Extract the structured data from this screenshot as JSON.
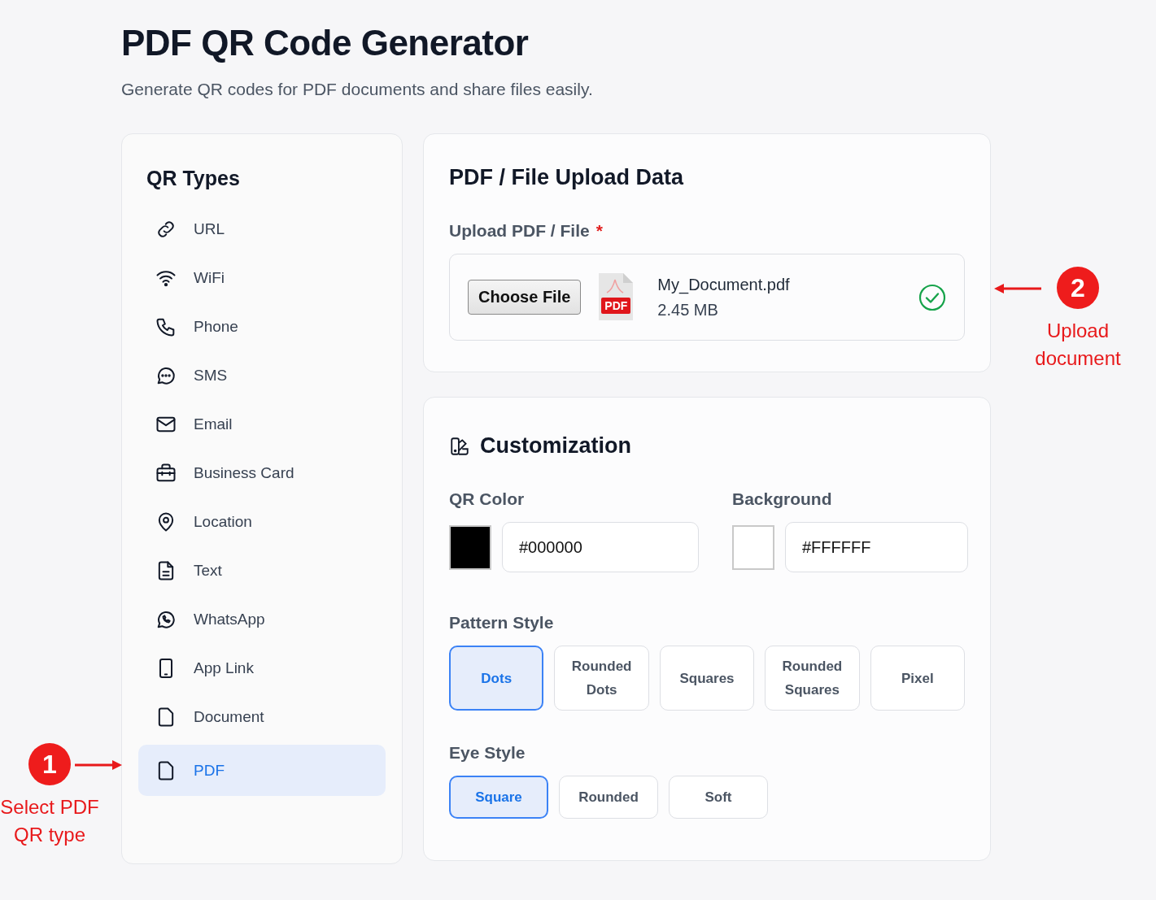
{
  "header": {
    "title": "PDF QR Code Generator",
    "subtitle": "Generate QR codes for PDF documents and share files easily."
  },
  "sidebar": {
    "title": "QR Types",
    "items": [
      {
        "kind": "link",
        "label": "URL",
        "selected": false
      },
      {
        "kind": "wifi",
        "label": "WiFi",
        "selected": false
      },
      {
        "kind": "phone",
        "label": "Phone",
        "selected": false
      },
      {
        "kind": "chat",
        "label": "SMS",
        "selected": false
      },
      {
        "kind": "mail",
        "label": "Email",
        "selected": false
      },
      {
        "kind": "briefcase",
        "label": "Business Card",
        "selected": false
      },
      {
        "kind": "pin",
        "label": "Location",
        "selected": false
      },
      {
        "kind": "text",
        "label": "Text",
        "selected": false
      },
      {
        "kind": "whatsapp",
        "label": "WhatsApp",
        "selected": false
      },
      {
        "kind": "device",
        "label": "App Link",
        "selected": false
      },
      {
        "kind": "file",
        "label": "Document",
        "selected": false
      },
      {
        "kind": "file",
        "label": "PDF",
        "selected": true
      }
    ]
  },
  "upload": {
    "title": "PDF / File Upload Data",
    "label": "Upload PDF / File",
    "required_mark": "*",
    "button": "Choose File",
    "file_badge": "PDF",
    "file_name": "My_Document.pdf",
    "file_size": "2.45 MB"
  },
  "customization": {
    "title": "Customization",
    "colors": [
      {
        "label": "QR Color",
        "value": "#000000",
        "color": "#000000"
      },
      {
        "label": "Background",
        "value": "#FFFFFF",
        "color": "#ffffff"
      }
    ],
    "pattern_style": {
      "label": "Pattern Style",
      "options": [
        {
          "label": "Dots",
          "selected": true
        },
        {
          "label": "Rounded Dots",
          "selected": false
        },
        {
          "label": "Squares",
          "selected": false
        },
        {
          "label": "Rounded Squares",
          "selected": false
        },
        {
          "label": "Pixel",
          "selected": false
        }
      ]
    },
    "eye_style": {
      "label": "Eye Style",
      "options": [
        {
          "label": "Square",
          "selected": true
        },
        {
          "label": "Rounded",
          "selected": false
        },
        {
          "label": "Soft",
          "selected": false
        }
      ]
    }
  },
  "annotations": [
    {
      "number": "1",
      "label": "Select PDF QR type",
      "kind": "left"
    },
    {
      "number": "2",
      "label": "Upload document",
      "kind": "right"
    }
  ]
}
